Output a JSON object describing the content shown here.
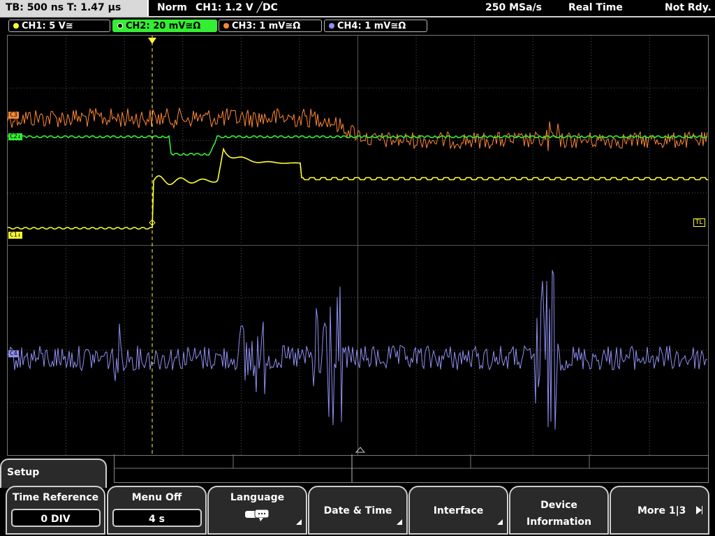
{
  "status": {
    "timebase": "TB: 500 ns   T: 1.47 µs",
    "trigger_mode": "Norm",
    "trigger_info": "CH1: 1.2 V ╱DC",
    "sample_rate": "250 MSa/s",
    "acq_mode": "Real Time",
    "state": "Not Rdy."
  },
  "channels": [
    {
      "label": "CH1: 5 V≅",
      "color": "#ffff33"
    },
    {
      "label": "CH2: 20 mV≅Ω",
      "color": "#33ee33"
    },
    {
      "label": "CH3: 1 mV≅Ω",
      "color": "#ff8833"
    },
    {
      "label": "CH4: 1 mV≅Ω",
      "color": "#8f8ff0"
    }
  ],
  "markers": {
    "c1": "C1↓",
    "c2": "C2↓",
    "c3": "C3",
    "c4": "C4",
    "trigger_level": "TL",
    "trigger_pos": "T"
  },
  "menu": {
    "title": "Setup",
    "time_reference": {
      "label": "Time Reference",
      "value": "0 DIV"
    },
    "menu_off": {
      "label": "Menu Off",
      "value": "4 s"
    },
    "language": {
      "label": "Language"
    },
    "date_time": {
      "label": "Date & Time"
    },
    "interface": {
      "label": "Interface"
    },
    "device_info": {
      "label1": "Device",
      "label2": "Information"
    },
    "more": {
      "label": "More 1|3"
    }
  },
  "icons": {
    "language": "speech-bubble-icon",
    "more": "arrow-right-icon"
  }
}
